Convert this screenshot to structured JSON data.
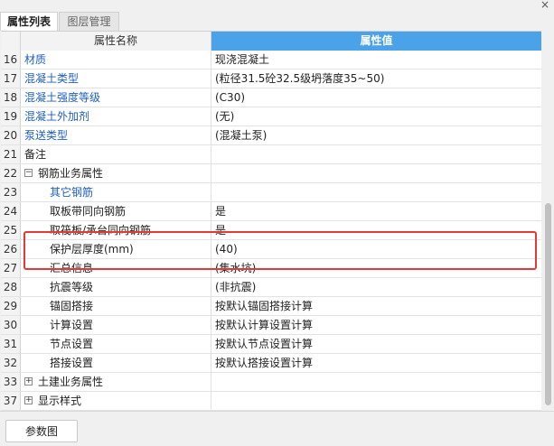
{
  "window": {
    "close_glyph": "×"
  },
  "tabs": [
    {
      "label": "属性列表",
      "active": true
    },
    {
      "label": "图层管理",
      "active": false
    }
  ],
  "table": {
    "header": {
      "name": "属性名称",
      "value": "属性值"
    },
    "rows": [
      {
        "num": "16",
        "name": "材质",
        "value": "现浇混凝土"
      },
      {
        "num": "17",
        "name": "混凝土类型",
        "value": "(粒径31.5砼32.5级坍落度35~50)"
      },
      {
        "num": "18",
        "name": "混凝土强度等级",
        "value": "(C30)"
      },
      {
        "num": "19",
        "name": "混凝土外加剂",
        "value": "(无)"
      },
      {
        "num": "20",
        "name": "泵送类型",
        "value": "(混凝土泵)"
      },
      {
        "num": "21",
        "name": "备注",
        "value": ""
      },
      {
        "num": "22",
        "name": "钢筋业务属性",
        "value": "",
        "expander": "−"
      },
      {
        "num": "23",
        "name": "其它钢筋",
        "value": ""
      },
      {
        "num": "24",
        "name": "取板带同向钢筋",
        "value": "是"
      },
      {
        "num": "25",
        "name": "取筏板/承台同向钢筋",
        "value": "是"
      },
      {
        "num": "26",
        "name": "保护层厚度(mm)",
        "value": "(40)"
      },
      {
        "num": "27",
        "name": "汇总信息",
        "value": "(集水坑)"
      },
      {
        "num": "28",
        "name": "抗震等级",
        "value": "(非抗震)"
      },
      {
        "num": "29",
        "name": "锚固搭接",
        "value": "按默认锚固搭接计算"
      },
      {
        "num": "30",
        "name": "计算设置",
        "value": "按默认计算设置计算"
      },
      {
        "num": "31",
        "name": "节点设置",
        "value": "按默认节点设置计算"
      },
      {
        "num": "32",
        "name": "搭接设置",
        "value": "按默认搭接设置计算"
      },
      {
        "num": "33",
        "name": "土建业务属性",
        "value": "",
        "expander": "+"
      },
      {
        "num": "37",
        "name": "显示样式",
        "value": "",
        "expander": "+"
      }
    ]
  },
  "footer": {
    "button_label": "参数图"
  },
  "colors": {
    "header_accent": "#4aa3e8",
    "link_blue": "#1f5fbf",
    "highlight_red": "#e53935"
  }
}
